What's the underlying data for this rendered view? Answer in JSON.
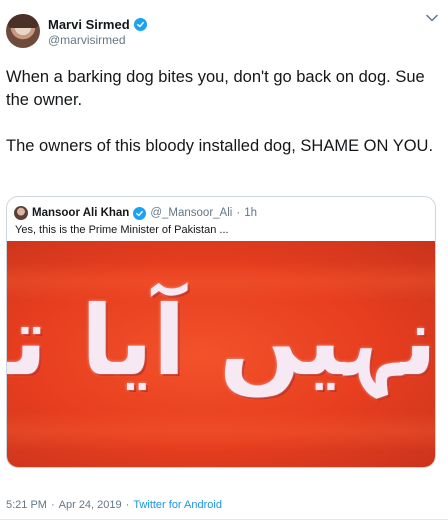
{
  "tweet": {
    "author": {
      "display_name": "Marvi Sirmed",
      "handle": "@marvisirmed",
      "verified": true
    },
    "paragraphs": [
      "When a barking dog bites you, don't go back on dog. Sue the owner.",
      "The owners of this bloody installed dog, SHAME ON YOU."
    ],
    "quoted": {
      "display_name": "Mansoor Ali Khan",
      "handle": "@_Mansoor_Ali",
      "separator": "·",
      "time": "1h",
      "text": "Yes, this is the Prime Minister of Pakistan ...",
      "image_text": "نہیں آیا تھا"
    },
    "footer": {
      "time": "5:21 PM",
      "separator1": "·",
      "date": "Apr 24, 2019",
      "separator2": "·",
      "source": "Twitter for Android"
    }
  },
  "colors": {
    "verified": "#1da1f2",
    "link": "#1b95e0",
    "secondary_text": "#657786",
    "image_red": "#e63d1f"
  },
  "icons": [
    "chevron-down-icon",
    "verified-badge-icon"
  ]
}
